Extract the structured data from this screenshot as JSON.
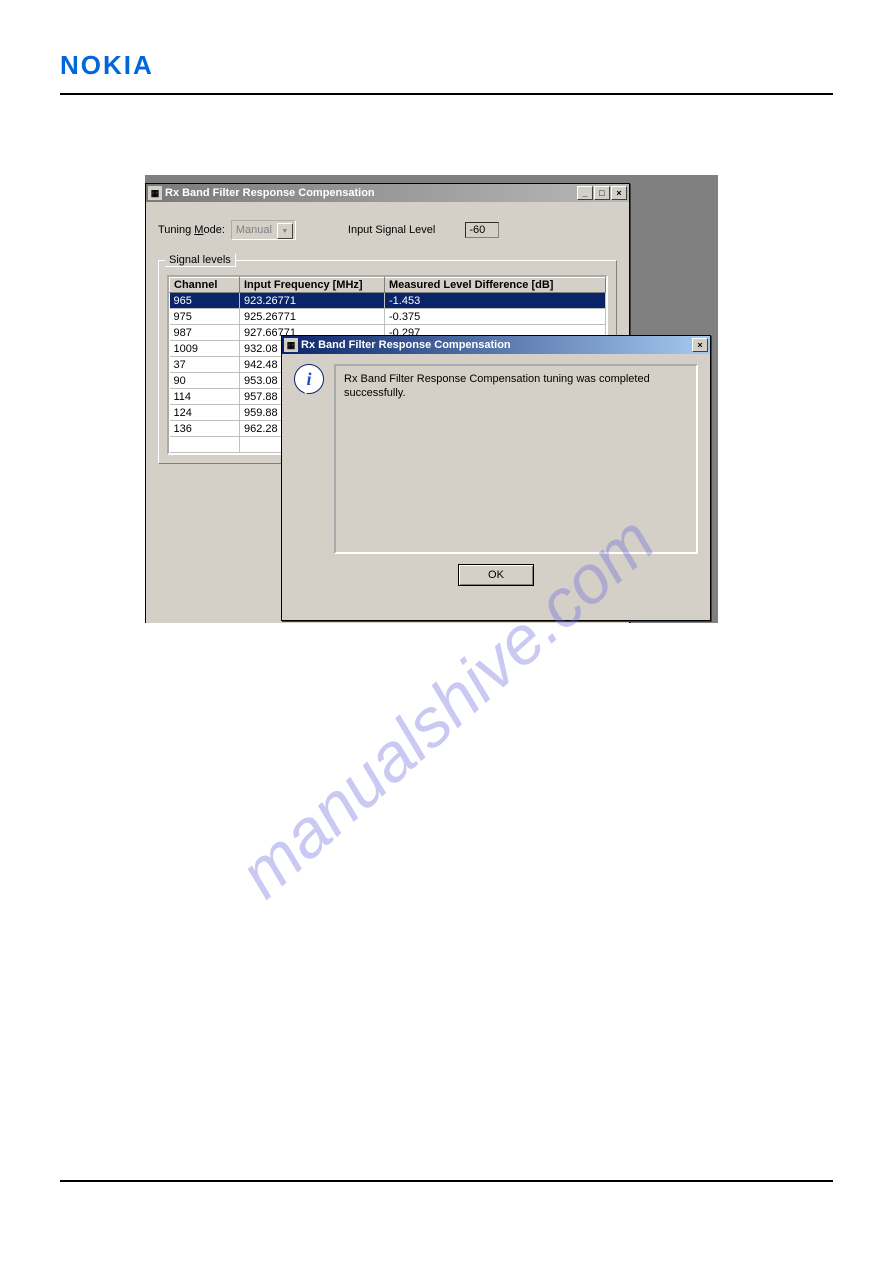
{
  "logo_text": "NOKIA",
  "watermark": "manualshive.com",
  "main_window": {
    "title": "Rx Band Filter Response Compensation",
    "tuning_mode_label_pre": "Tuning ",
    "tuning_mode_underline": "M",
    "tuning_mode_label_post": "ode:",
    "tuning_mode_value": "Manual",
    "input_signal_label": "Input Signal Level",
    "input_signal_value": "-60",
    "group_legend": "Signal levels",
    "headers": {
      "channel": "Channel",
      "freq": "Input Frequency [MHz]",
      "level": "Measured Level Difference [dB]"
    },
    "rows": [
      {
        "channel": "965",
        "freq": "923.26771",
        "level": "-1.453",
        "selected": true
      },
      {
        "channel": "975",
        "freq": "925.26771",
        "level": "-0.375",
        "selected": false
      },
      {
        "channel": "987",
        "freq": "927.66771",
        "level": "-0.297",
        "selected": false
      },
      {
        "channel": "1009",
        "freq": "932.08",
        "level": "",
        "selected": false
      },
      {
        "channel": "37",
        "freq": "942.48",
        "level": "",
        "selected": false
      },
      {
        "channel": "90",
        "freq": "953.08",
        "level": "",
        "selected": false
      },
      {
        "channel": "114",
        "freq": "957.88",
        "level": "",
        "selected": false
      },
      {
        "channel": "124",
        "freq": "959.88",
        "level": "",
        "selected": false
      },
      {
        "channel": "136",
        "freq": "962.28",
        "level": "",
        "selected": false
      },
      {
        "channel": "",
        "freq": "",
        "level": "",
        "selected": false
      }
    ]
  },
  "dialog": {
    "title": "Rx Band Filter Response Compensation",
    "message": "Rx Band Filter Response Compensation tuning was completed successfully.",
    "ok_label": "OK"
  },
  "winbtn": {
    "min": "_",
    "max": "□",
    "close": "×"
  }
}
